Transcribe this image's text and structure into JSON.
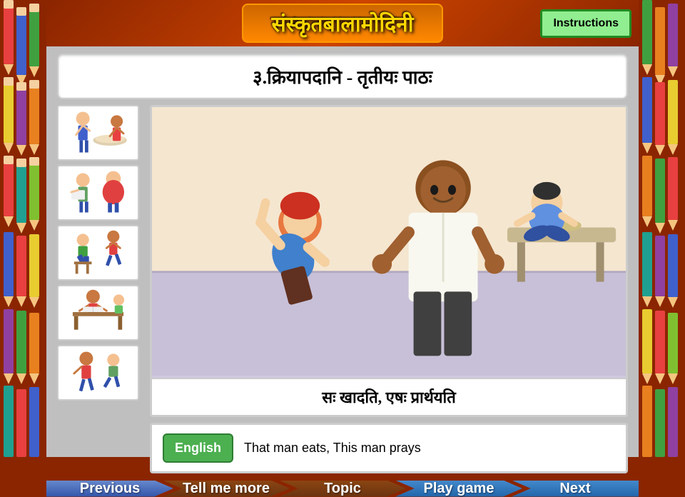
{
  "app": {
    "title": "संस्कृतबालामोदिनी",
    "instructions_label": "Instructions"
  },
  "lesson": {
    "title": "३.क्रियापदानि - तृतीयः पाठः",
    "sanskrit_text": "सः खादति, एषः प्रार्थयति",
    "english_badge": "English",
    "english_text": "That man eats, This man prays"
  },
  "nav": {
    "previous": "Previous",
    "tell_more": "Tell me more",
    "topic": "Topic",
    "play_game": "Play game",
    "next": "Next"
  },
  "colors": {
    "accent_green": "#90ee90",
    "border_green": "#228B22",
    "header_bg": "#8B2500",
    "title_bg": "#cc4400",
    "nav_blue": "#4488cc",
    "nav_brown": "#8B4513"
  }
}
